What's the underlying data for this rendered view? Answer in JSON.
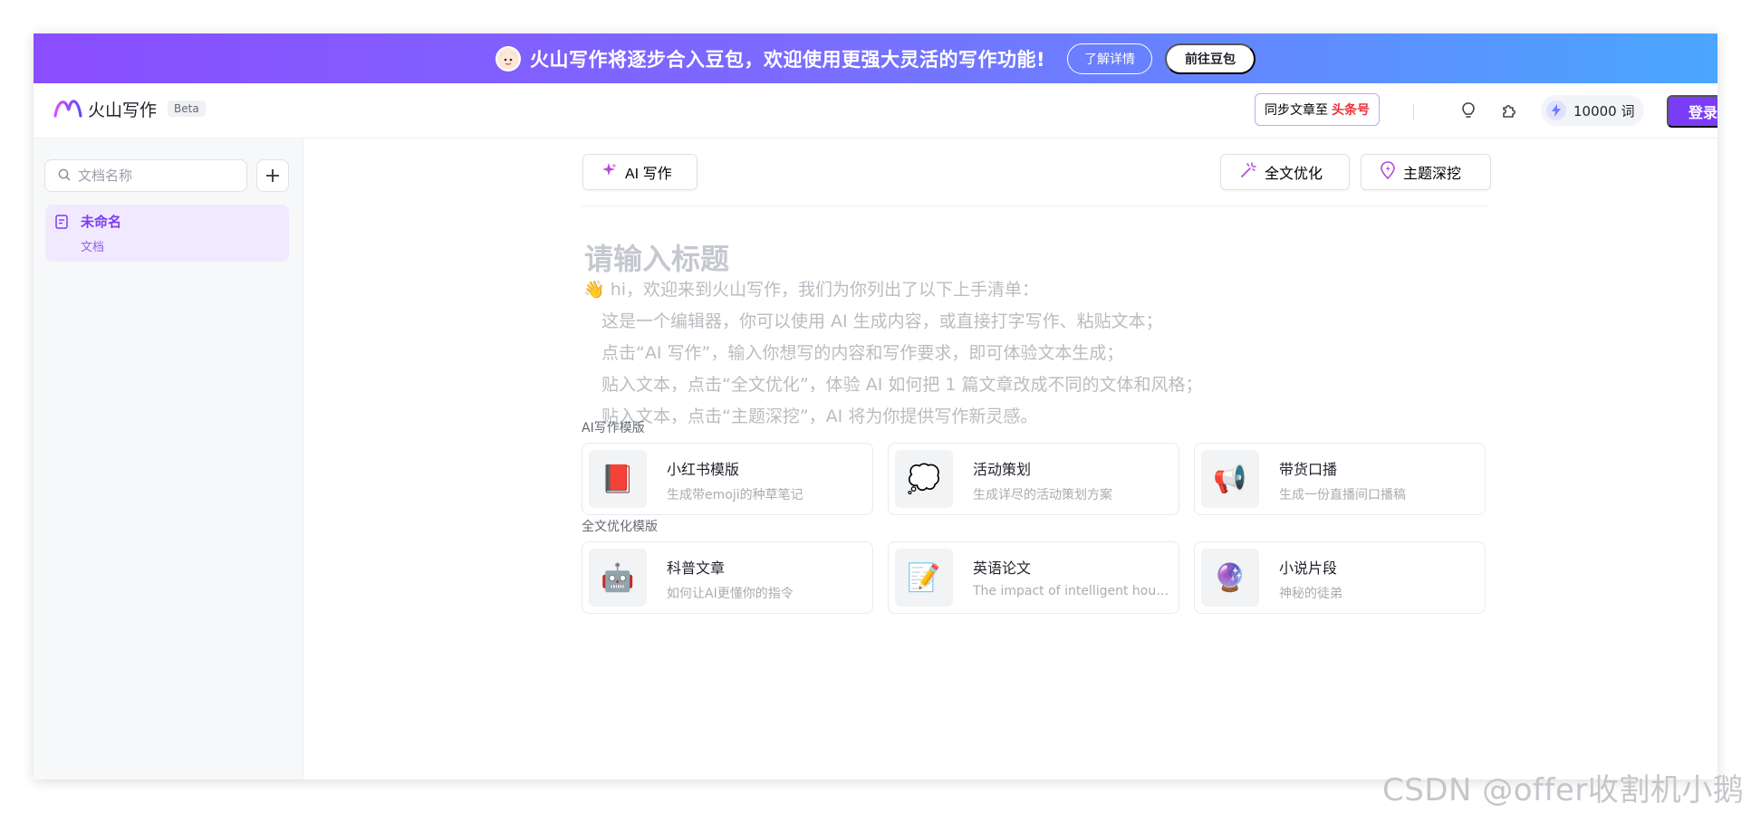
{
  "banner": {
    "text": "火山写作将逐步合入豆包，欢迎使用更强大灵活的写作功能!",
    "learn_more": "了解详情",
    "go_doubao": "前往豆包"
  },
  "header": {
    "logo_text": "火山写作",
    "beta": "Beta",
    "sync_prefix": "同步文章至",
    "sync_target": "头条号",
    "credits": "10000 词",
    "login": "登录"
  },
  "sidebar": {
    "search_placeholder": "文档名称",
    "docs": [
      {
        "title": "未命名",
        "type": "文档"
      }
    ]
  },
  "toolbar": {
    "ai_write": "AI 写作",
    "optimize": "全文优化",
    "deep_dive": "主题深挖"
  },
  "editor": {
    "title_placeholder": "请输入标题",
    "intro_lines": [
      "👋 hi，欢迎来到火山写作，我们为你列出了以下上手清单：",
      "这是一个编辑器，你可以使用 AI 生成内容，或直接打字写作、粘贴文本；",
      "点击“AI 写作”，输入你想写的内容和写作要求，即可体验文本生成；",
      "贴入文本，点击“全文优化”，体验 AI 如何把 1 篇文章改成不同的文体和风格；",
      "贴入文本，点击“主题深挖”，AI 将为你提供写作新灵感。"
    ]
  },
  "templates": {
    "ai_label": "AI写作模版",
    "ai_cards": [
      {
        "icon": "red-book-icon",
        "emoji": "📕",
        "title": "小红书模版",
        "subtitle": "生成带emoji的种草笔记"
      },
      {
        "icon": "thought-bubble-icon",
        "emoji": "💭",
        "title": "活动策划",
        "subtitle": "生成详尽的活动策划方案"
      },
      {
        "icon": "megaphone-icon",
        "emoji": "📢",
        "title": "带货口播",
        "subtitle": "生成一份直播间口播稿"
      }
    ],
    "optimize_label": "全文优化模版",
    "optimize_cards": [
      {
        "icon": "robot-icon",
        "emoji": "🤖",
        "title": "科普文章",
        "subtitle": "如何让AI更懂你的指令"
      },
      {
        "icon": "memo-icon",
        "emoji": "📝",
        "title": "英语论文",
        "subtitle": "The impact of intelligent household appliances"
      },
      {
        "icon": "crystal-ball-icon",
        "emoji": "🔮",
        "title": "小说片段",
        "subtitle": "神秘的徒弟"
      }
    ]
  },
  "watermark": "CSDN @offer收割机小鹅",
  "colors": {
    "accent": "#7b3cf5",
    "sync_highlight": "#e8343a"
  }
}
